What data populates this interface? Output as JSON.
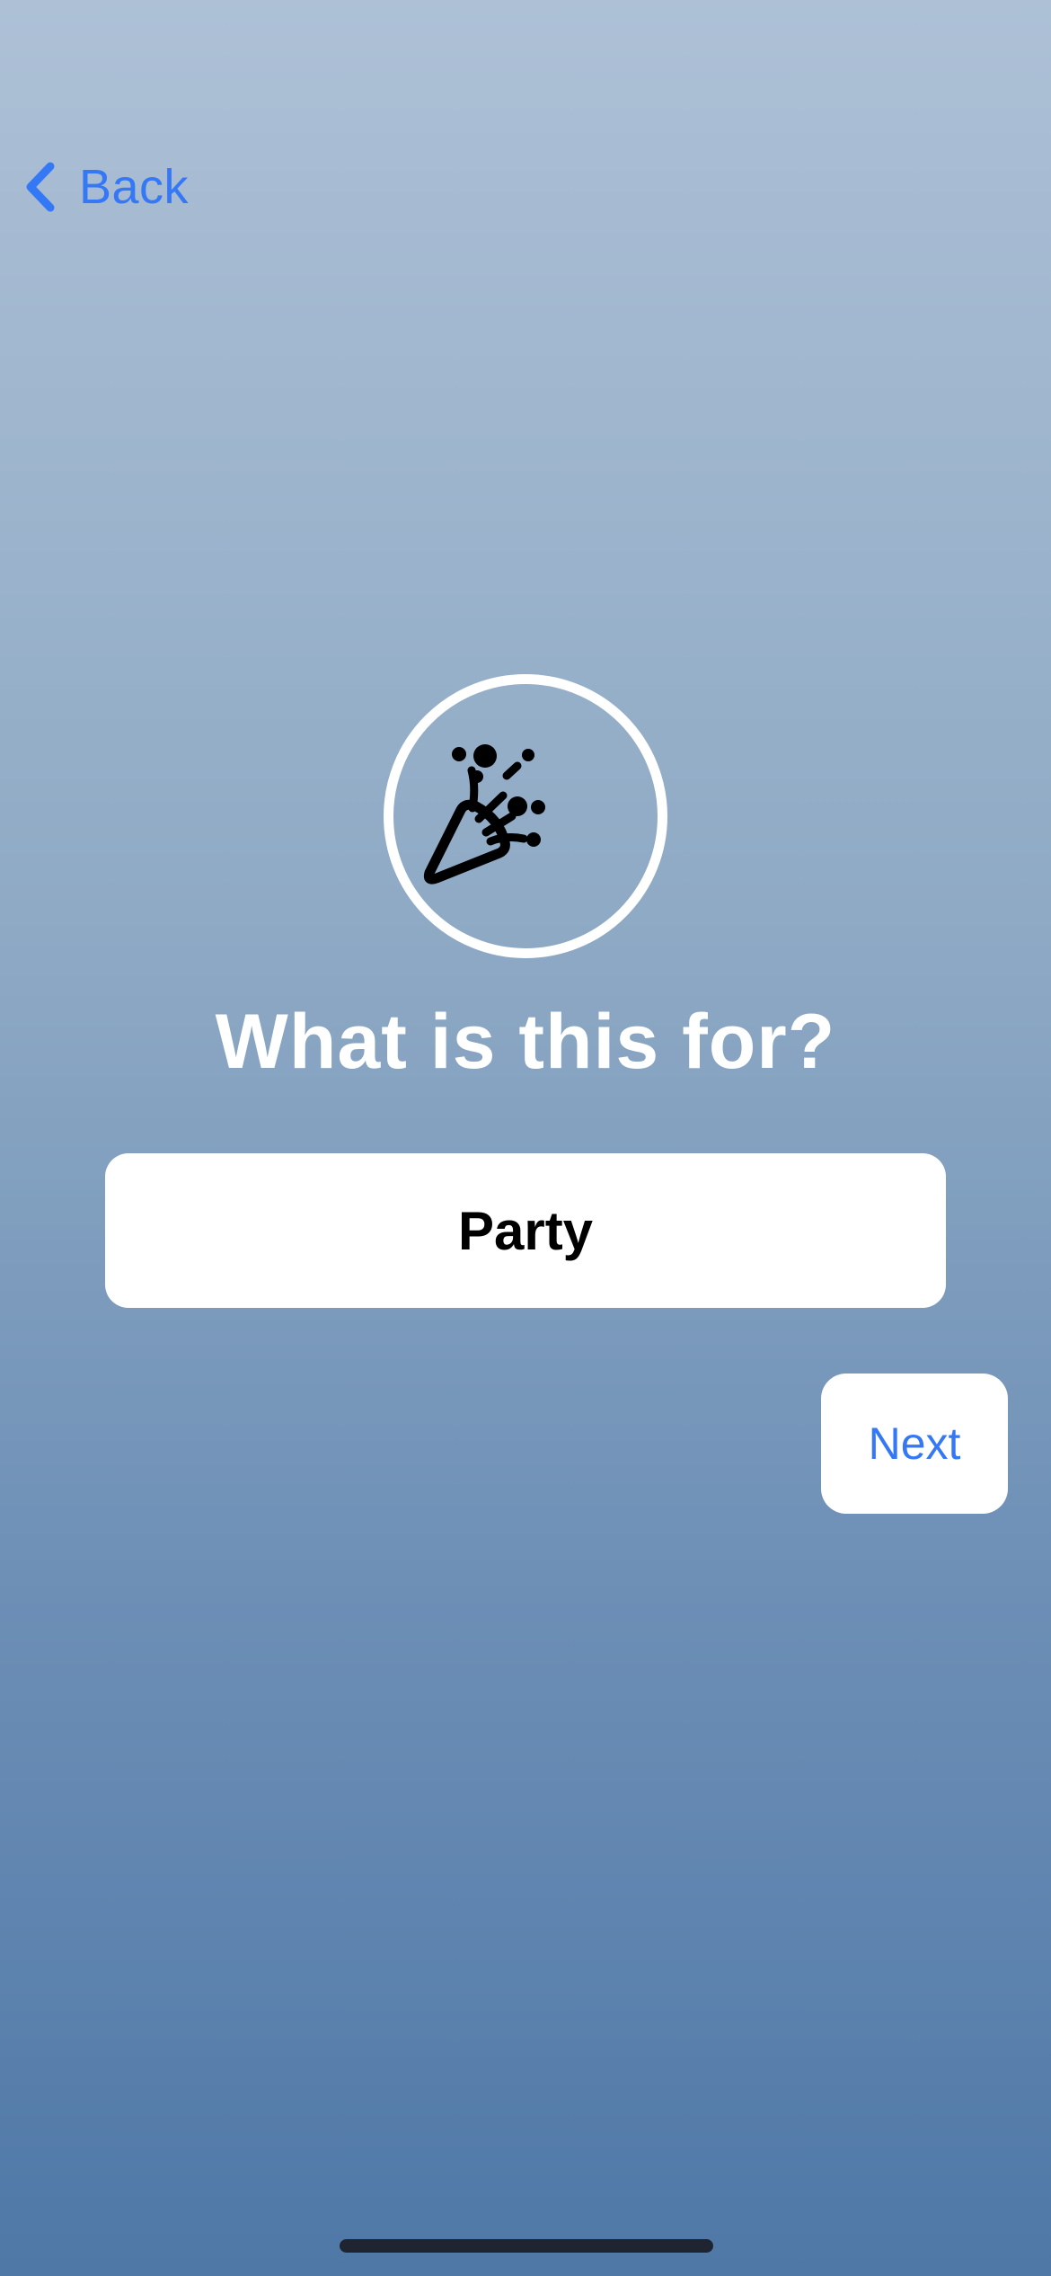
{
  "nav": {
    "back_label": "Back",
    "back_icon": "chevron-left-icon"
  },
  "hero": {
    "icon": "party-popper-icon"
  },
  "title": "What is this for?",
  "choice": {
    "label": "Party"
  },
  "actions": {
    "next_label": "Next"
  },
  "colors": {
    "accent": "#3478f6",
    "background_top": "#adc0d6",
    "background_bottom": "#4f78a7"
  }
}
